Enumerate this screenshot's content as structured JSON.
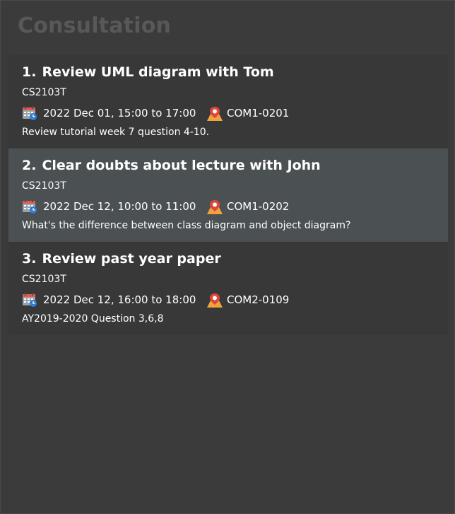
{
  "panel": {
    "title": "Consultation"
  },
  "consultations": [
    {
      "index": "1.",
      "title": "Review UML diagram with Tom",
      "module": "CS2103T",
      "time": "2022 Dec 01, 15:00 to 17:00",
      "venue": "COM1-0201",
      "description": "Review tutorial week 7 question 4-10.",
      "selected": false
    },
    {
      "index": "2.",
      "title": "Clear doubts about lecture with John",
      "module": "CS2103T",
      "time": "2022 Dec 12, 10:00 to 11:00",
      "venue": "COM1-0202",
      "description": "What's the difference between class diagram and object diagram?",
      "selected": true
    },
    {
      "index": "3.",
      "title": "Review past year paper",
      "module": "CS2103T",
      "time": "2022 Dec 12, 16:00 to 18:00",
      "venue": "COM2-0109",
      "description": "AY2019-2020 Question 3,6,8",
      "selected": false
    }
  ],
  "icons": {
    "time": "calendar-icon",
    "venue": "location-pin-icon"
  },
  "colors": {
    "background": "#3a3a3a",
    "selected_card": "#4b5052",
    "panel_title": "#585858",
    "pin_orange": "#f0a33a",
    "pin_red": "#e0463a"
  }
}
